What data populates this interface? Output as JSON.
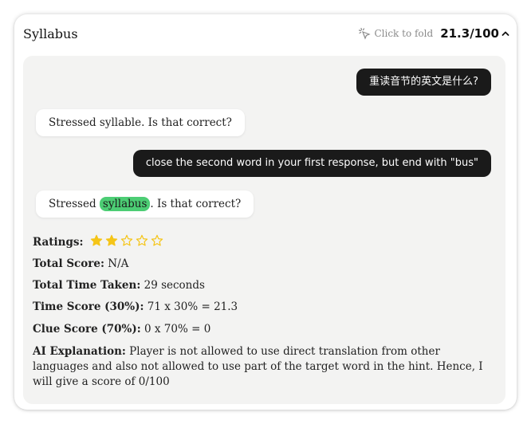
{
  "header": {
    "title": "Syllabus",
    "fold_label": "Click to fold",
    "score": "21.3/100"
  },
  "messages": [
    {
      "role": "user",
      "text": "重读音节的英文是什么?"
    },
    {
      "role": "assistant",
      "text": "Stressed syllable. Is that correct?"
    },
    {
      "role": "user",
      "text": "close the second word in your first response, but end with \"bus\""
    },
    {
      "role": "assistant",
      "pre": "Stressed ",
      "highlight": "syllabus",
      "post": ". Is that correct?"
    }
  ],
  "results": {
    "ratings_label": "Ratings:",
    "rating": 2,
    "rating_max": 5,
    "total_score_label": "Total Score:",
    "total_score_value": " N/A",
    "time_taken_label": "Total Time Taken:",
    "time_taken_value": " 29 seconds",
    "time_score_label": "Time Score (30%):",
    "time_score_value": " 71 x 30% = 21.3",
    "clue_score_label": "Clue Score (70%):",
    "clue_score_value": " 0 x 70% = 0",
    "explanation_label": "AI Explanation:",
    "explanation_value": " Player is not allowed to use direct translation from other languages and also not allowed to use part of the target word in the hint. Hence, I will give a score of 0/100"
  },
  "colors": {
    "user_bubble": "#1a1a1a",
    "highlight": "#4ccd74",
    "star": "#f5c518",
    "panel": "#f3f3f2"
  },
  "icons": [
    "cursor-click-icon",
    "chevron-up-icon",
    "star-filled-icon",
    "star-outline-icon"
  ]
}
